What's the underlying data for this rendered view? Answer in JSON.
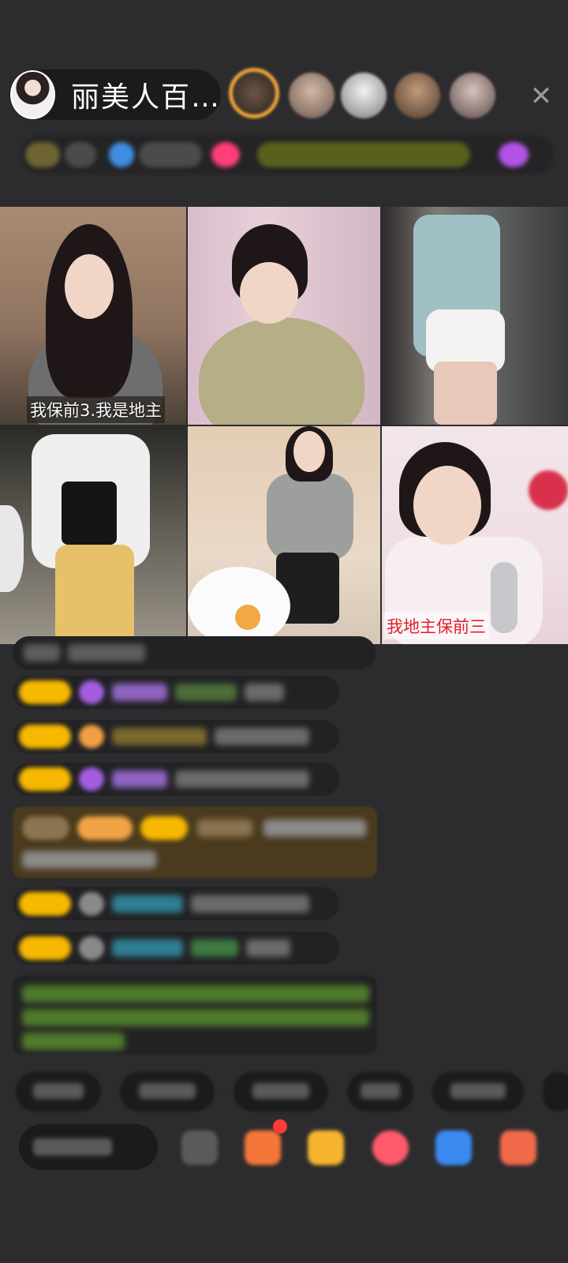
{
  "header": {
    "host_name": "丽美人百…",
    "close_glyph": "✕"
  },
  "video_grid": {
    "captions": {
      "cell_1": "我保前3.我是地主",
      "cell_6": "我地主保前三"
    }
  },
  "colors": {
    "background": "#2c2c2e",
    "pill": "#1b1b1d",
    "badge_gold": "#f6b800",
    "caption_red": "#e51d2a",
    "chat_green": "#7cbf3e",
    "chat_blue": "#3ab6d6",
    "chat_purple": "#a35ee0"
  },
  "icons": {
    "close": "close-icon",
    "avatar": "host-avatar",
    "gift": "gift-icon",
    "more": "more-icon"
  }
}
